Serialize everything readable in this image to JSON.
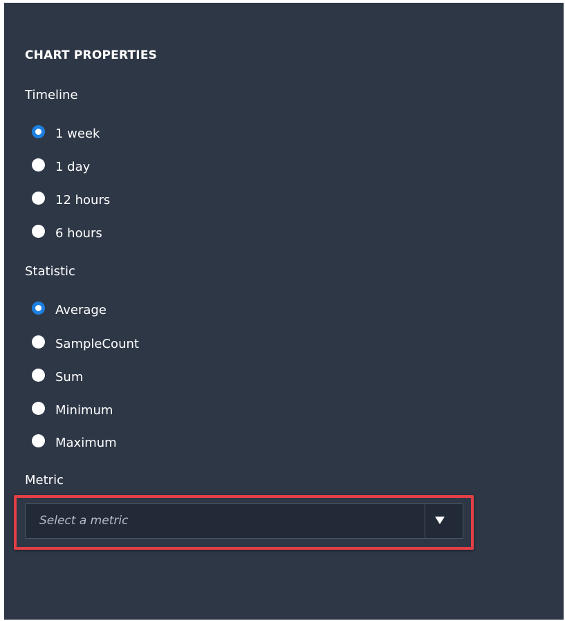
{
  "panel": {
    "title": "CHART PROPERTIES"
  },
  "timeline": {
    "label": "Timeline",
    "options": [
      {
        "label": "1 week",
        "selected": true
      },
      {
        "label": "1 day",
        "selected": false
      },
      {
        "label": "12 hours",
        "selected": false
      },
      {
        "label": "6 hours",
        "selected": false
      }
    ]
  },
  "statistic": {
    "label": "Statistic",
    "options": [
      {
        "label": "Average",
        "selected": true
      },
      {
        "label": "SampleCount",
        "selected": false
      },
      {
        "label": "Sum",
        "selected": false
      },
      {
        "label": "Minimum",
        "selected": false
      },
      {
        "label": "Maximum",
        "selected": false
      }
    ]
  },
  "metric": {
    "label": "Metric",
    "placeholder": "Select a metric",
    "dropdown_icon": "caret-down-icon"
  },
  "colors": {
    "panel_bg": "#2e3746",
    "selected_radio": "#1d7fe0",
    "highlight": "#e33f46"
  }
}
